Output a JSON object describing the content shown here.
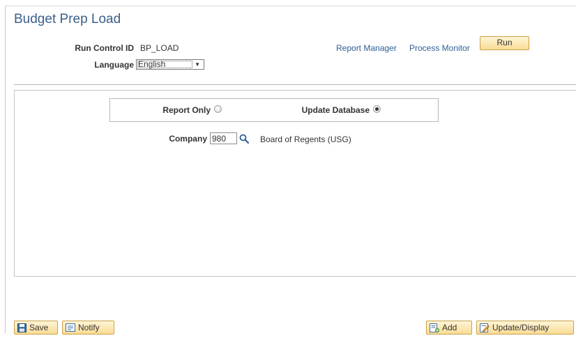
{
  "page": {
    "title": "Budget Prep Load"
  },
  "header": {
    "run_control_label": "Run Control ID",
    "run_control_value": "BP_LOAD",
    "language_label": "Language",
    "language_value": "English",
    "report_manager_link": "Report Manager",
    "process_monitor_link": "Process Monitor",
    "run_button": "Run"
  },
  "options": {
    "report_only_label": "Report Only",
    "report_only_selected": false,
    "update_database_label": "Update Database",
    "update_database_selected": true
  },
  "company": {
    "label": "Company",
    "value": "980",
    "description": "Board of Regents (USG)"
  },
  "toolbar": {
    "save_label": "Save",
    "notify_label": "Notify",
    "add_label": "Add",
    "update_display_label": "Update/Display"
  },
  "icons": {
    "lookup": "magnifier-icon",
    "save": "floppy-disk-icon",
    "notify": "notify-envelope-icon",
    "add": "add-page-icon",
    "update_display": "update-display-icon"
  },
  "colors": {
    "title": "#3a5f8a",
    "link": "#2e5d96",
    "button_top": "#fff5d6",
    "button_bottom": "#f9dc95",
    "button_border": "#c9a14a"
  }
}
